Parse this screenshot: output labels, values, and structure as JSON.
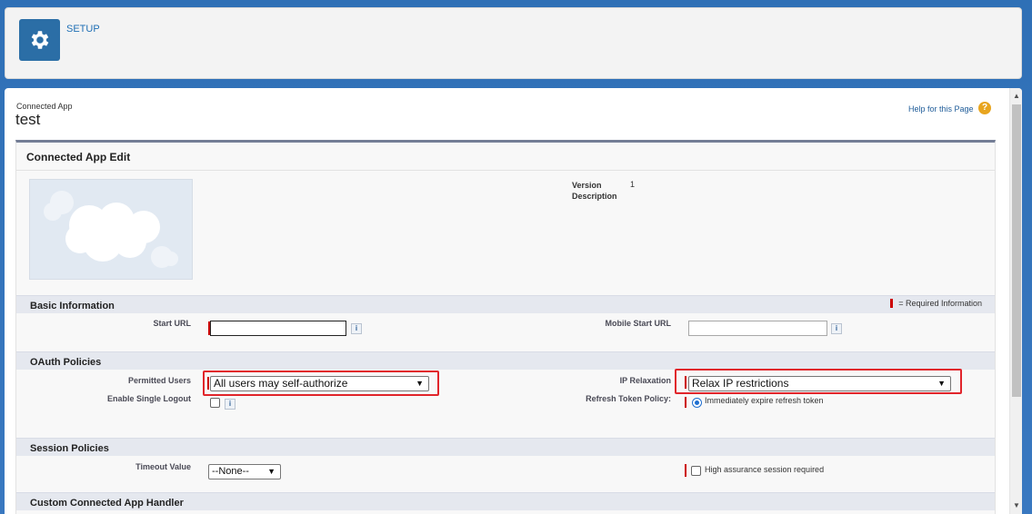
{
  "header": {
    "setup_label": "SETUP",
    "icon": "gear-icon"
  },
  "page": {
    "breadcrumb_type": "Connected App",
    "title": "test",
    "help_link": "Help for this Page",
    "help_icon": "?"
  },
  "edit": {
    "title": "Connected App Edit",
    "version_label": "Version",
    "description_label": "Description",
    "version_value": "1"
  },
  "basic_info": {
    "title": "Basic Information",
    "required_legend": "= Required Information",
    "start_url_label": "Start URL",
    "start_url_value": "",
    "mobile_start_url_label": "Mobile Start URL",
    "mobile_start_url_value": ""
  },
  "oauth": {
    "title": "OAuth Policies",
    "permitted_users_label": "Permitted Users",
    "permitted_users_value": "All users may self-authorize",
    "ip_relaxation_label": "IP Relaxation",
    "ip_relaxation_value": "Relax IP restrictions",
    "single_logout_label": "Enable Single Logout",
    "refresh_token_label": "Refresh Token Policy:",
    "refresh_token_option": "Immediately expire refresh token"
  },
  "session": {
    "title": "Session Policies",
    "timeout_label": "Timeout Value",
    "timeout_value": "--None--",
    "high_assurance_label": "High assurance session required"
  },
  "custom_handler": {
    "title": "Custom Connected App Handler"
  },
  "info_glyph": "i",
  "colors": {
    "accent": "#2b6ea6",
    "required": "#cc0000",
    "highlight": "#e1252b"
  }
}
